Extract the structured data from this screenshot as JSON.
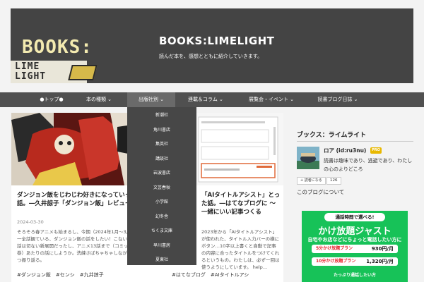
{
  "header": {
    "logo_books": "BOOKS:",
    "logo_lime": "LIME",
    "logo_light": "LIGHT",
    "title": "BOOKS:LIMELIGHT",
    "description": "読んだ本を、感想とともに紹介していきます。"
  },
  "nav": {
    "items": [
      {
        "label": "●トップ●"
      },
      {
        "label": "本の種類 ⌄"
      },
      {
        "label": "出版社別 ⌄"
      },
      {
        "label": "連載＆コラム ⌄"
      },
      {
        "label": "展覧会・イベント ⌄"
      },
      {
        "label": "読書ブログ日誌 ⌄"
      }
    ]
  },
  "dropdown": {
    "items": [
      "新潮社",
      "角川書店",
      "集英社",
      "講談社",
      "岩波書店",
      "文芸春秋",
      "小学館",
      "幻冬舎",
      "ちくま文庫",
      "早川書房",
      "夏東社"
    ]
  },
  "cards": [
    {
      "title": "ダンジョン飯をじわじわ好きになっていった話。―久井諒子「ダンジョン飯」レビュー",
      "date": "2024-03-30",
      "excerpt": "そろそろ春アニメも始まるし、今期（2024年1月〜3月）に唯一全話観ている、ダンジョン飯の話をしたい！こないだの最新話は切ない新展開だったし、アニメ13話まで（コミックス1〜4巻）あたりの話にしようか。洗練さばちゃちゃしながら少しずつ振り返る。",
      "tags": "#ダンジョン飯　#センシ　#九井諒子"
    },
    {
      "title": "「AIタイトルアシスト」とった話。―はてなブログに ～一緒にいい記事つくる",
      "date": "",
      "excerpt": "2023年から「AIタイトルアシスト」が使われた、タイトル入力バーの横にボタン…10字以上書くと自動で記事の内容に合ったタイトルをつけてくれるというもの。わたしは、必ず一回は使うようにしています。 help…",
      "tags": "#はてなブログ　#AIタイトルアシ"
    }
  ],
  "sidebar": {
    "title": "ブックス：ライムライト",
    "username": "ロア (id:ru3nu)",
    "pro": "PRO",
    "bio": "読書は趣味であり、逃避であり、わたしの心のよりどころ",
    "follow": "+ 読者になる",
    "follower_count": "126",
    "about": "このブログについて"
  },
  "ad": {
    "top": "通話時間で選べる!",
    "headline": "かけ放題ジャスト",
    "sub": "自宅やお店などにちょっと電話したい方に",
    "plans": [
      {
        "label": "5分かけ放題プラン",
        "price": "930円/月"
      },
      {
        "label": "10分かけ放題プラン",
        "price": "1,320円/月"
      }
    ],
    "note": "たっぷり通話したい方"
  }
}
